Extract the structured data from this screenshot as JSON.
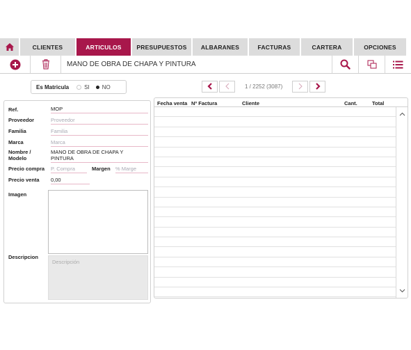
{
  "nav": {
    "tabs": [
      {
        "label": "CLIENTES",
        "active": false
      },
      {
        "label": "ARTICULOS",
        "active": true
      },
      {
        "label": "PRESUPUESTOS",
        "active": false
      },
      {
        "label": "ALBARANES",
        "active": false
      },
      {
        "label": "FACTURAS",
        "active": false
      },
      {
        "label": "CARTERA",
        "active": false
      },
      {
        "label": "OPCIONES",
        "active": false
      }
    ]
  },
  "toolbar": {
    "title": "MANO DE OBRA DE CHAPA Y PINTURA",
    "icons": [
      "add-icon",
      "trash-icon",
      "search-icon",
      "duplicate-icon",
      "list-icon"
    ]
  },
  "matricula": {
    "label": "Es Matricula",
    "option_si": "SI",
    "option_no": "NO",
    "selected": "NO"
  },
  "pager": {
    "text": "1 / 2252 (3087)"
  },
  "form": {
    "ref_label": "Ref.",
    "ref_value": "MOP",
    "proveedor_label": "Proveedor",
    "proveedor_placeholder": "Proveedor",
    "familia_label": "Familia",
    "familia_placeholder": "Familia",
    "marca_label": "Marca",
    "marca_placeholder": "Marca",
    "nombre_label_1": "Nombre /",
    "nombre_label_2": "Modelo",
    "nombre_value_1": "MANO DE OBRA DE CHAPA Y",
    "nombre_value_2": "PINTURA",
    "precio_compra_label": "Precio compra",
    "precio_compra_placeholder": "P. Compra",
    "margen_label": "Margen",
    "margen_placeholder": "% Marge",
    "precio_venta_label": "Precio venta",
    "precio_venta_value": "0,00",
    "imagen_label": "Imagen",
    "descripcion_label": "Descripcion",
    "descripcion_placeholder": "Descripción"
  },
  "table": {
    "columns": [
      "Fecha venta",
      "Nº Factura",
      "Cliente",
      "Cant.",
      "Total"
    ],
    "rows": []
  },
  "colors": {
    "accent": "#a8174b",
    "tab_bg": "#dcdcdc"
  }
}
